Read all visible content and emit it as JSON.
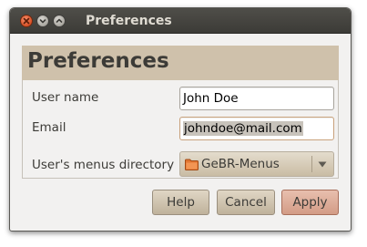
{
  "window": {
    "title": "Preferences"
  },
  "header": {
    "title": "Preferences"
  },
  "form": {
    "fields": [
      {
        "label": "User name",
        "value": "John Doe"
      },
      {
        "label": "Email",
        "value": "johndoe@mail.com"
      }
    ],
    "menus_dir": {
      "label": "User's menus directory",
      "value": "GeBR-Menus",
      "icon": "folder-icon"
    }
  },
  "buttons": {
    "help": "Help",
    "cancel": "Cancel",
    "apply": "Apply"
  },
  "colors": {
    "titlebar": "#3c3b37",
    "header_band": "#cfc1ab",
    "close_button": "#d95026",
    "apply_button": "#d39c86"
  }
}
